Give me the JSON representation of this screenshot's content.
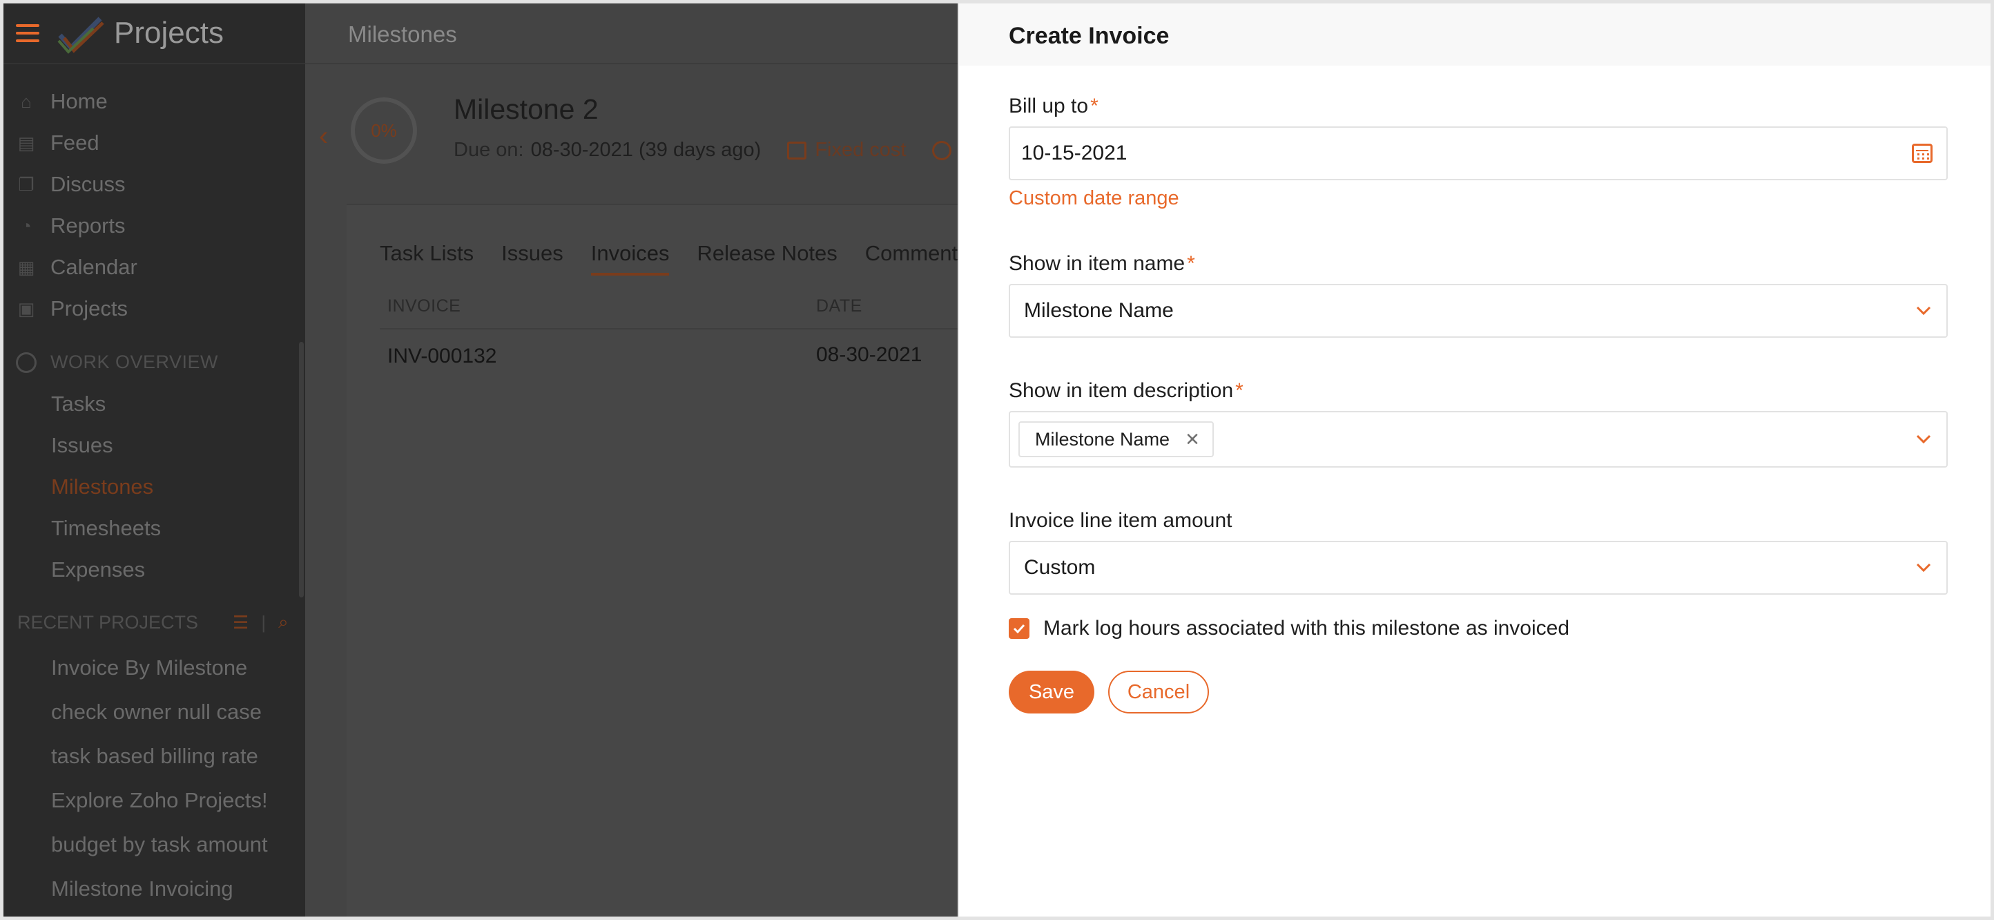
{
  "app": {
    "title": "Projects"
  },
  "sidebar": {
    "nav": [
      {
        "label": "Home",
        "icon": "home-icon"
      },
      {
        "label": "Feed",
        "icon": "feed-icon"
      },
      {
        "label": "Discuss",
        "icon": "discuss-icon"
      },
      {
        "label": "Reports",
        "icon": "reports-icon"
      },
      {
        "label": "Calendar",
        "icon": "calendar-icon"
      },
      {
        "label": "Projects",
        "icon": "briefcase-icon"
      }
    ],
    "work_overview": {
      "header": "WORK OVERVIEW",
      "items": [
        "Tasks",
        "Issues",
        "Milestones",
        "Timesheets",
        "Expenses"
      ],
      "active": "Milestones"
    },
    "recent_projects": {
      "header": "RECENT PROJECTS",
      "items": [
        "Invoice By Milestone",
        "check owner null case",
        "task based billing rate",
        "Explore Zoho Projects!",
        "budget by task amount",
        "Milestone Invoicing"
      ]
    }
  },
  "main": {
    "page_title": "Milestones",
    "milestone": {
      "progress": "0%",
      "name": "Milestone 2",
      "due_label": "Due on:",
      "due_value": "08-30-2021 (39 days ago)",
      "billing_type": "Fixed cost"
    },
    "tabs": [
      {
        "label": "Task Lists",
        "active": false
      },
      {
        "label": "Issues",
        "active": false
      },
      {
        "label": "Invoices",
        "active": true
      },
      {
        "label": "Release Notes",
        "active": false
      },
      {
        "label": "Comments",
        "active": false
      }
    ],
    "table": {
      "columns": [
        "INVOICE",
        "DATE"
      ],
      "rows": [
        [
          "INV-000132",
          "08-30-2021"
        ]
      ]
    }
  },
  "drawer": {
    "title": "Create Invoice",
    "bill_up_to": {
      "label": "Bill up to",
      "value": "10-15-2021"
    },
    "custom_date_range": "Custom date range",
    "show_in_item_name": {
      "label": "Show in item name",
      "value": "Milestone Name"
    },
    "show_in_item_description": {
      "label": "Show in item description",
      "chip": "Milestone Name"
    },
    "invoice_line_item_amount": {
      "label": "Invoice line item amount",
      "value": "Custom"
    },
    "mark_log_hours": {
      "label": "Mark log hours associated with this milestone as invoiced",
      "checked": true
    },
    "save_label": "Save",
    "cancel_label": "Cancel",
    "required_mark": "*"
  },
  "colors": {
    "accent": "#e8692b",
    "overlay_dark": "#444444",
    "sidebar_dark": "#2a2a2a"
  }
}
